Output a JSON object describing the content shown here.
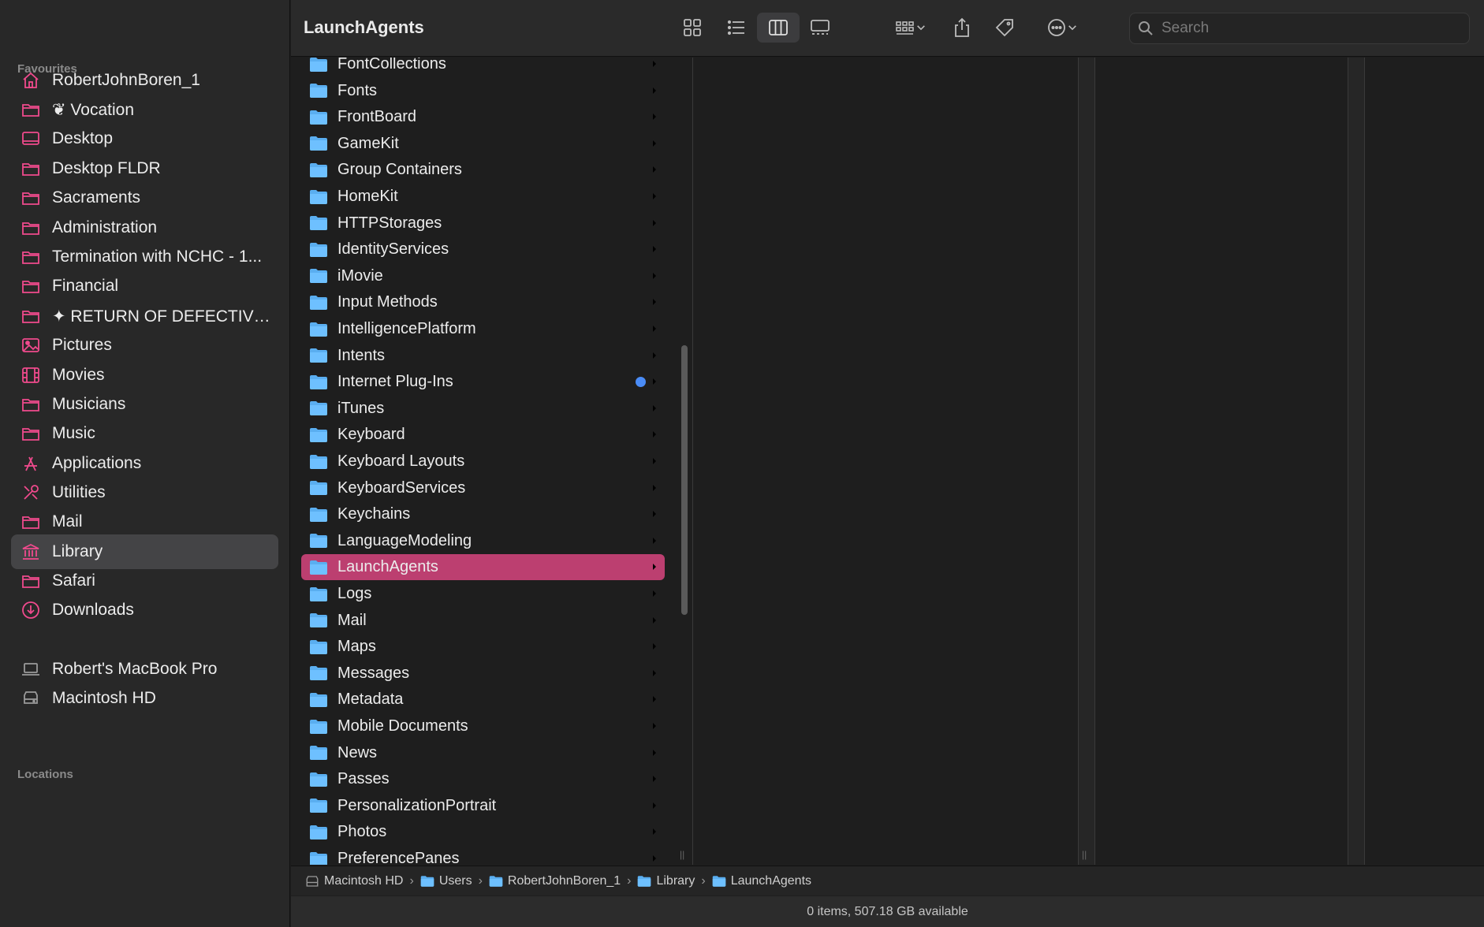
{
  "window": {
    "title": "LaunchAgents"
  },
  "colors": {
    "accent": "#bc3f70",
    "sidebar_icon": "#f04a8d",
    "folder": "#5aaef0",
    "tag_blue": "#4a8cf7"
  },
  "sidebar": {
    "favourites_label": "Favourites",
    "locations_label": "Locations",
    "favourites": [
      {
        "label": "RobertJohnBoren_1",
        "icon": "home-icon"
      },
      {
        "label": "❦ Vocation",
        "icon": "folder-icon"
      },
      {
        "label": "Desktop",
        "icon": "desktop-icon"
      },
      {
        "label": "Desktop FLDR",
        "icon": "folder-icon"
      },
      {
        "label": "Sacraments",
        "icon": "folder-icon"
      },
      {
        "label": "Administration",
        "icon": "folder-icon"
      },
      {
        "label": " Termination with NCHC - 1...",
        "icon": "folder-icon"
      },
      {
        "label": "Financial",
        "icon": "folder-icon"
      },
      {
        "label": "✦ RETURN OF DEFECTIVE...",
        "icon": "folder-icon"
      },
      {
        "label": "Pictures",
        "icon": "pictures-icon"
      },
      {
        "label": "Movies",
        "icon": "movies-icon"
      },
      {
        "label": "Musicians",
        "icon": "folder-icon"
      },
      {
        "label": "Music",
        "icon": "folder-icon"
      },
      {
        "label": "Applications",
        "icon": "applications-icon"
      },
      {
        "label": "Utilities",
        "icon": "utilities-icon"
      },
      {
        "label": "Mail",
        "icon": "folder-icon"
      },
      {
        "label": "Library",
        "icon": "library-icon",
        "selected": true
      },
      {
        "label": "Safari",
        "icon": "folder-icon"
      },
      {
        "label": "Downloads",
        "icon": "downloads-icon"
      }
    ],
    "locations": [
      {
        "label": "Robert's MacBook Pro",
        "icon": "laptop-icon"
      },
      {
        "label": "Macintosh HD",
        "icon": "drive-icon"
      }
    ]
  },
  "toolbar": {
    "search_placeholder": "Search",
    "active_view": "column",
    "buttons": [
      "icon-view",
      "list-view",
      "column-view",
      "gallery-view",
      "group-by",
      "share",
      "tag",
      "more-actions"
    ]
  },
  "column1": {
    "items": [
      {
        "name": "FontCollections"
      },
      {
        "name": "Fonts"
      },
      {
        "name": "FrontBoard"
      },
      {
        "name": "GameKit"
      },
      {
        "name": "Group Containers"
      },
      {
        "name": "HomeKit"
      },
      {
        "name": "HTTPStorages"
      },
      {
        "name": "IdentityServices"
      },
      {
        "name": "iMovie"
      },
      {
        "name": "Input Methods"
      },
      {
        "name": "IntelligencePlatform"
      },
      {
        "name": "Intents"
      },
      {
        "name": "Internet Plug-Ins",
        "tag": "blue"
      },
      {
        "name": "iTunes"
      },
      {
        "name": "Keyboard"
      },
      {
        "name": "Keyboard Layouts"
      },
      {
        "name": "KeyboardServices"
      },
      {
        "name": "Keychains"
      },
      {
        "name": "LanguageModeling"
      },
      {
        "name": "LaunchAgents",
        "selected": true
      },
      {
        "name": "Logs"
      },
      {
        "name": "Mail"
      },
      {
        "name": "Maps"
      },
      {
        "name": "Messages"
      },
      {
        "name": "Metadata"
      },
      {
        "name": "Mobile Documents"
      },
      {
        "name": "News"
      },
      {
        "name": "Passes"
      },
      {
        "name": "PersonalizationPortrait"
      },
      {
        "name": "Photos"
      },
      {
        "name": "PreferencePanes"
      }
    ]
  },
  "pathbar": [
    {
      "label": "Macintosh HD",
      "icon": "drive-icon"
    },
    {
      "label": "Users",
      "icon": "folder-icon"
    },
    {
      "label": "RobertJohnBoren_1",
      "icon": "folder-icon"
    },
    {
      "label": "Library",
      "icon": "folder-icon"
    },
    {
      "label": "LaunchAgents",
      "icon": "folder-icon"
    }
  ],
  "status": {
    "text": "0 items, 507.18 GB available"
  }
}
